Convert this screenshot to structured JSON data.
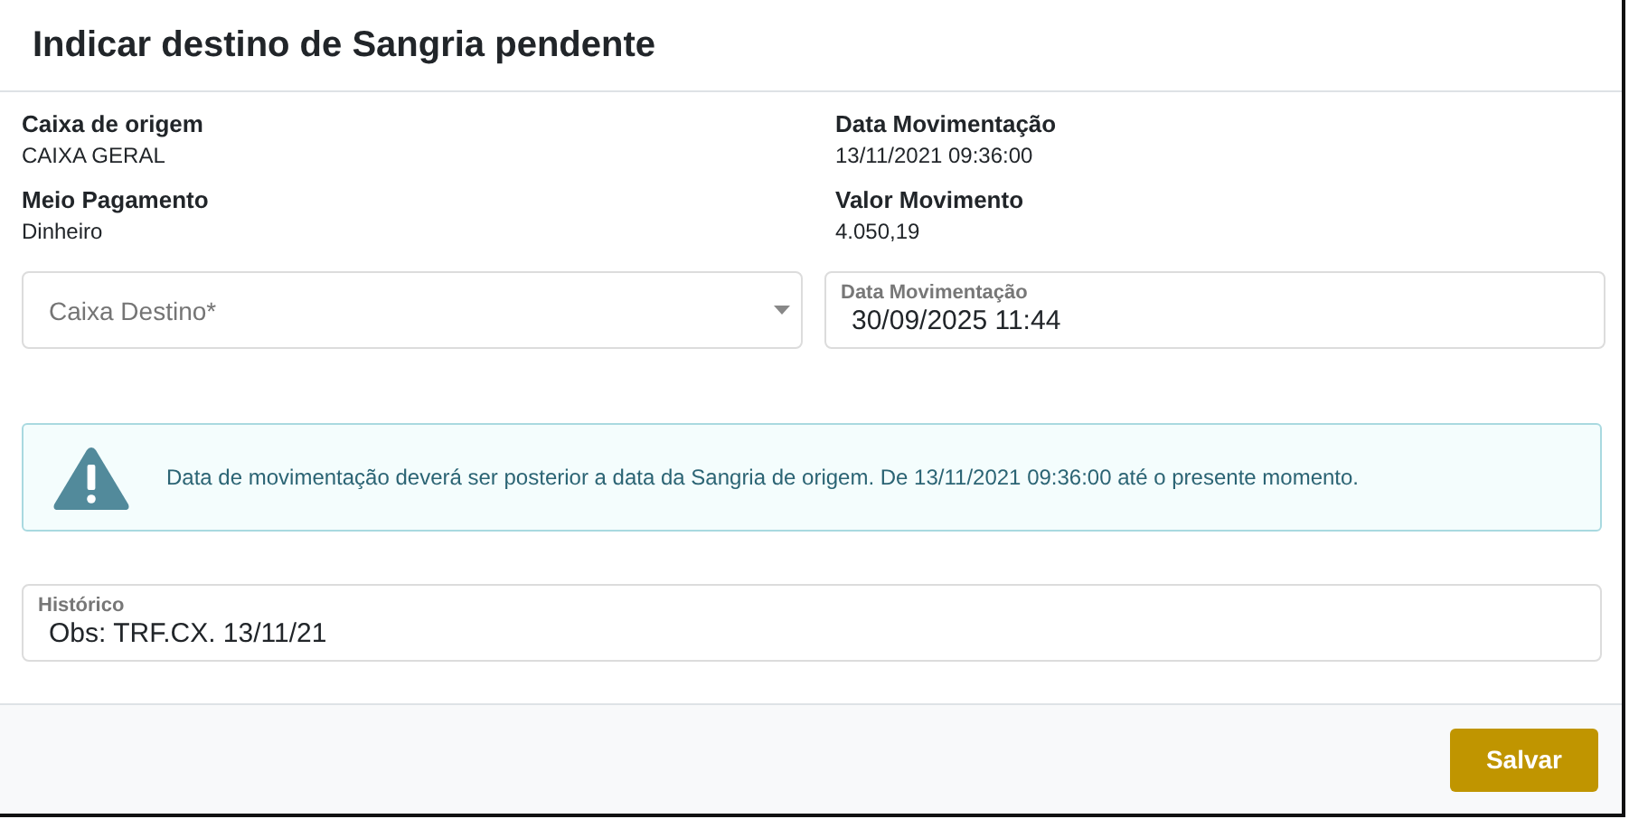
{
  "window": {
    "title": "Indicar destino de Sangria pendente"
  },
  "details": [
    {
      "label": "Caixa de origem",
      "value": "CAIXA GERAL"
    },
    {
      "label": "Data Movimentação",
      "value": "13/11/2021 09:36:00"
    },
    {
      "label": "Meio Pagamento",
      "value": "Dinheiro"
    },
    {
      "label": "Valor Movimento",
      "value": "4.050,19"
    }
  ],
  "fields": [
    {
      "kind": "select",
      "placeholder": "Caixa Destino*"
    },
    {
      "kind": "text",
      "label": "Data Movimentação",
      "value": "30/09/2025 11:44"
    }
  ],
  "alert": {
    "text": "Data de movimentação deverá ser posterior a data da Sangria de origem. De 13/11/2021 09:36:00 até o presente momento."
  },
  "history": {
    "label": "Histórico",
    "value": "Obs: TRF.CX. 13/11/21"
  },
  "buttons": [
    "Salvar"
  ]
}
